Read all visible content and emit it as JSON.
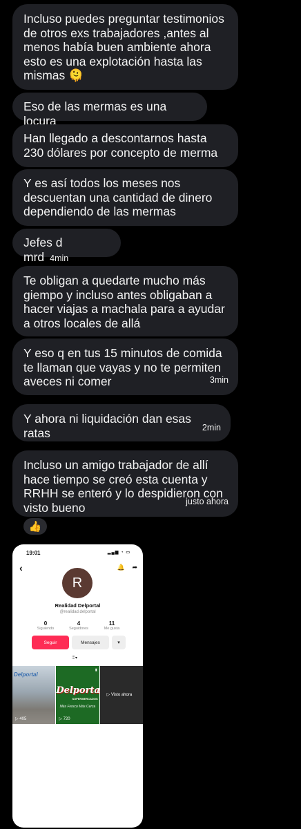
{
  "messages": [
    {
      "text": "Incluso puedes preguntar testimonios de otros exs trabajadores ,antes al menos había buen ambiente ahora esto es una explotación hasta las mismas 🫠",
      "time": ""
    },
    {
      "text": "Eso de las mermas es una locura",
      "time": ""
    },
    {
      "text": "Han llegado a descontarnos hasta 230 dólares por concepto de merma",
      "time": ""
    },
    {
      "text": "Y es así todos los meses nos descuentan una cantidad de dinero dependiendo de las mermas",
      "time": ""
    },
    {
      "text": "Jefes d mrd",
      "time": "4min"
    },
    {
      "text": "Te obligan a quedarte mucho más giempo y incluso antes obligaban a hacer viajas a machala para a ayudar a otros locales de allá",
      "time": ""
    },
    {
      "text": "Y eso q en tus 15 minutos de comida te llaman que vayas y no te permiten aveces ni comer",
      "time": "3min"
    },
    {
      "text": "Y ahora ni liquidación dan esas ratas",
      "time": "2min"
    },
    {
      "text": "Incluso un amigo trabajador de allí hace tiempo se creó esta cuenta y RRHH se enteró y lo despidieron con visto bueno",
      "time": "justo ahora"
    }
  ],
  "reaction": "👍",
  "phone": {
    "clock": "19:01",
    "status_icons": "▂▄▆ ◔ ▭",
    "back_icon": "‹",
    "bell_icon": "🔔",
    "share_icon": "➦",
    "avatar_letter": "R",
    "profile_name": "Realidad Delportal",
    "handle": "@realidad.delportal",
    "stats": [
      {
        "value": "0",
        "label": "Siguiendo"
      },
      {
        "value": "4",
        "label": "Seguidores"
      },
      {
        "value": "11",
        "label": "Me gusta"
      }
    ],
    "follow_label": "Seguir",
    "message_label": "Mensajes",
    "more_label": "▾",
    "grid_icon": "⦙⦙⦙▾",
    "videos": [
      {
        "overlay": "Delportal",
        "views": "▷ 405"
      },
      {
        "overlay": "Delportal",
        "sub": "SUPERMERCADOS",
        "tag": "Más Fresco Más Cerca",
        "views": "▷ 720"
      },
      {
        "overlay": "▷ Visto ahora",
        "views": ""
      }
    ]
  }
}
